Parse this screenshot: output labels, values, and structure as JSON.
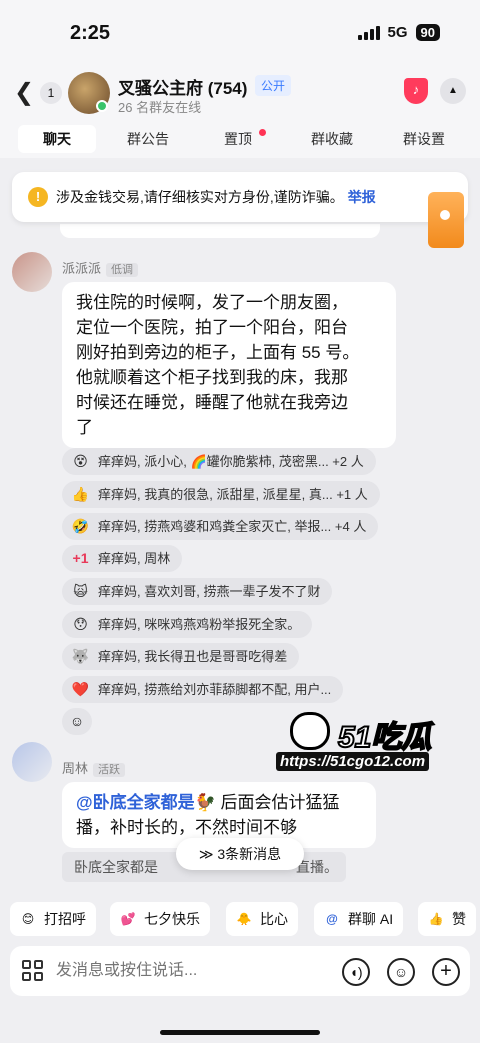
{
  "status": {
    "time": "2:25",
    "network": "5G",
    "battery": "90"
  },
  "header": {
    "unread": "1",
    "title": "叉骚公主府 (754)",
    "badge": "公开",
    "subtitle": "26 名群友在线"
  },
  "tabs": [
    "聊天",
    "群公告",
    "置顶",
    "群收藏",
    "群设置"
  ],
  "warning": {
    "text": "涉及金钱交易,请仔细核实对方身份,谨防诈骗。",
    "link": "举报"
  },
  "messages": [
    {
      "sender": "派派派",
      "tag": "低调",
      "lines": [
        "我住院的时候啊，发了一个朋友圈，",
        "定位一个医院，拍了一个阳台，阳台",
        "刚好拍到旁边的柜子，上面有 55 号。",
        "他就顺着这个柜子找到我的床，我那",
        "时候还在睡觉，睡醒了他就在我旁边",
        "了"
      ]
    },
    {
      "sender": "周林",
      "tag": "活跃",
      "mention": "@卧底全家都是",
      "line1": " 后面会估计猛猛",
      "line2": "播，补时长的，不然时间不够"
    }
  ],
  "reactions": [
    {
      "emoji": "😵",
      "text": "痒痒妈, 派小心, 🌈罐你脆紫柿, 茂密黑... +2 人"
    },
    {
      "emoji": "👍",
      "text": "痒痒妈, 我真的很急, 派甜星, 派星星, 真... +1 人"
    },
    {
      "emoji": "🤣",
      "text": "痒痒妈, 捞燕鸡婆和鸡粪全家灭亡, 举报... +4 人"
    },
    {
      "emoji": "+1",
      "text": "痒痒妈, 周林"
    },
    {
      "emoji": "🙀",
      "text": "痒痒妈, 喜欢刘哥, 捞燕一辈子发不了财"
    },
    {
      "emoji": "😯",
      "text": "痒痒妈, 咪咪鸡燕鸡粉举报死全家。"
    },
    {
      "emoji": "🐺",
      "text": "痒痒妈, 我长得丑也是哥哥吃得差"
    },
    {
      "emoji": "❤️",
      "text": "痒痒妈, 捞燕给刘亦菲舔脚都不配, 用户..."
    }
  ],
  "reply_preview": {
    "left": "卧底全家都是",
    "right": "直播。"
  },
  "watermark": {
    "logo": "51吃瓜",
    "url": "https://51cgo12.com"
  },
  "new_messages": "≫ 3条新消息",
  "quick_actions": [
    {
      "icon": "😊",
      "label": "打招呼"
    },
    {
      "icon": "💕",
      "label": "七夕快乐"
    },
    {
      "icon": "🐥",
      "label": "比心"
    },
    {
      "icon": "@",
      "label": "群聊 AI"
    },
    {
      "icon": "👍",
      "label": "赞"
    }
  ],
  "composer": {
    "placeholder": "发消息或按住说话..."
  }
}
